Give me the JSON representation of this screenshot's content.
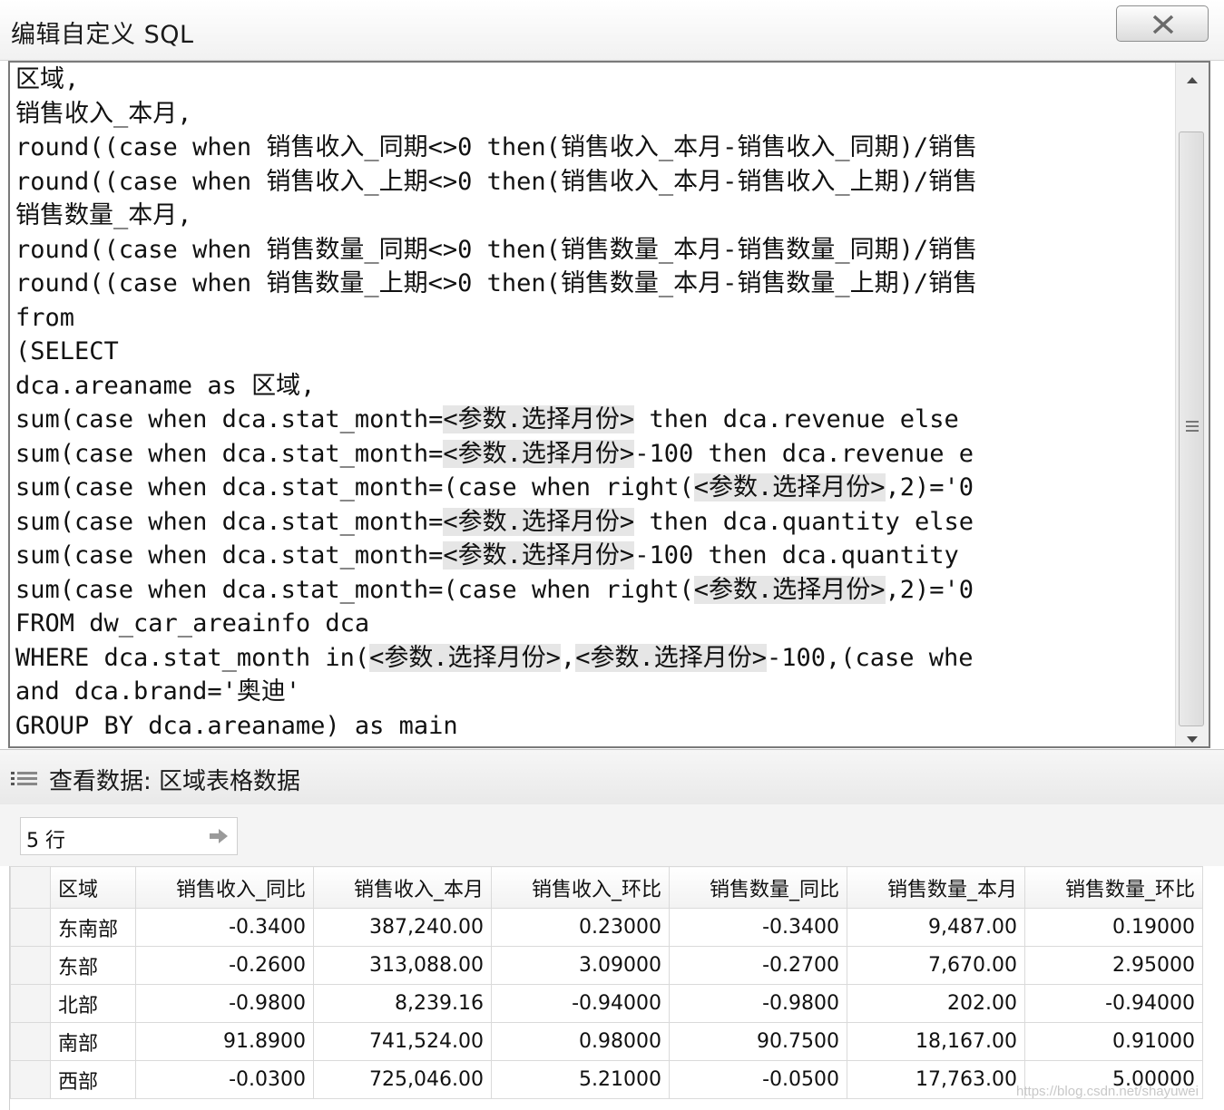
{
  "window": {
    "title": "编辑自定义 SQL"
  },
  "editor": {
    "lines": [
      [
        {
          "t": "区域,"
        }
      ],
      [
        {
          "t": "销售收入_本月,"
        }
      ],
      [
        {
          "t": "round((case when 销售收入_同期<>0 then(销售收入_本月-销售收入_同期)/销售"
        }
      ],
      [
        {
          "t": "round((case when 销售收入_上期<>0 then(销售收入_本月-销售收入_上期)/销售"
        }
      ],
      [
        {
          "t": "销售数量_本月,"
        }
      ],
      [
        {
          "t": "round((case when 销售数量_同期<>0 then(销售数量_本月-销售数量_同期)/销售"
        }
      ],
      [
        {
          "t": "round((case when 销售数量_上期<>0 then(销售数量_本月-销售数量_上期)/销售"
        }
      ],
      [
        {
          "t": "from"
        }
      ],
      [
        {
          "t": "(SELECT"
        }
      ],
      [
        {
          "t": "dca.areaname as 区域,"
        }
      ],
      [
        {
          "t": "sum(case when dca.stat_month="
        },
        {
          "t": "<参数.选择月份>",
          "p": true
        },
        {
          "t": " then dca.revenue else "
        }
      ],
      [
        {
          "t": "sum(case when dca.stat_month="
        },
        {
          "t": "<参数.选择月份>",
          "p": true
        },
        {
          "t": "-100 then dca.revenue e"
        }
      ],
      [
        {
          "t": "sum(case when dca.stat_month=(case when right("
        },
        {
          "t": "<参数.选择月份>",
          "p": true
        },
        {
          "t": ",2)='0"
        }
      ],
      [
        {
          "t": "sum(case when dca.stat_month="
        },
        {
          "t": "<参数.选择月份>",
          "p": true
        },
        {
          "t": " then dca.quantity else"
        }
      ],
      [
        {
          "t": "sum(case when dca.stat_month="
        },
        {
          "t": "<参数.选择月份>",
          "p": true
        },
        {
          "t": "-100 then dca.quantity "
        }
      ],
      [
        {
          "t": "sum(case when dca.stat_month=(case when right("
        },
        {
          "t": "<参数.选择月份>",
          "p": true
        },
        {
          "t": ",2)='0"
        }
      ],
      [
        {
          "t": "FROM dw_car_areainfo dca"
        }
      ],
      [
        {
          "t": "WHERE dca.stat_month in("
        },
        {
          "t": "<参数.选择月份>",
          "p": true
        },
        {
          "t": ","
        },
        {
          "t": "<参数.选择月份>",
          "p": true
        },
        {
          "t": "-100,(case whe"
        }
      ],
      [
        {
          "t": "and dca.brand='奥迪'"
        }
      ],
      [
        {
          "t": "GROUP BY dca.areaname) as main"
        }
      ]
    ]
  },
  "view_panel": {
    "title": "查看数据: 区域表格数据",
    "row_count": "5 行"
  },
  "table": {
    "columns": [
      "区域",
      "销售收入_同比",
      "销售收入_本月",
      "销售收入_环比",
      "销售数量_同比",
      "销售数量_本月",
      "销售数量_环比"
    ],
    "rows": [
      [
        "东南部",
        "-0.3400",
        "387,240.00",
        "0.23000",
        "-0.3400",
        "9,487.00",
        "0.19000"
      ],
      [
        "东部",
        "-0.2600",
        "313,088.00",
        "3.09000",
        "-0.2700",
        "7,670.00",
        "2.95000"
      ],
      [
        "北部",
        "-0.9800",
        "8,239.16",
        "-0.94000",
        "-0.9800",
        "202.00",
        "-0.94000"
      ],
      [
        "南部",
        "91.8900",
        "741,524.00",
        "0.98000",
        "90.7500",
        "18,167.00",
        "0.91000"
      ],
      [
        "西部",
        "-0.0300",
        "725,046.00",
        "5.21000",
        "-0.0500",
        "17,763.00",
        "5.00000"
      ]
    ]
  },
  "watermark": "https://blog.csdn.net/shayuwei"
}
